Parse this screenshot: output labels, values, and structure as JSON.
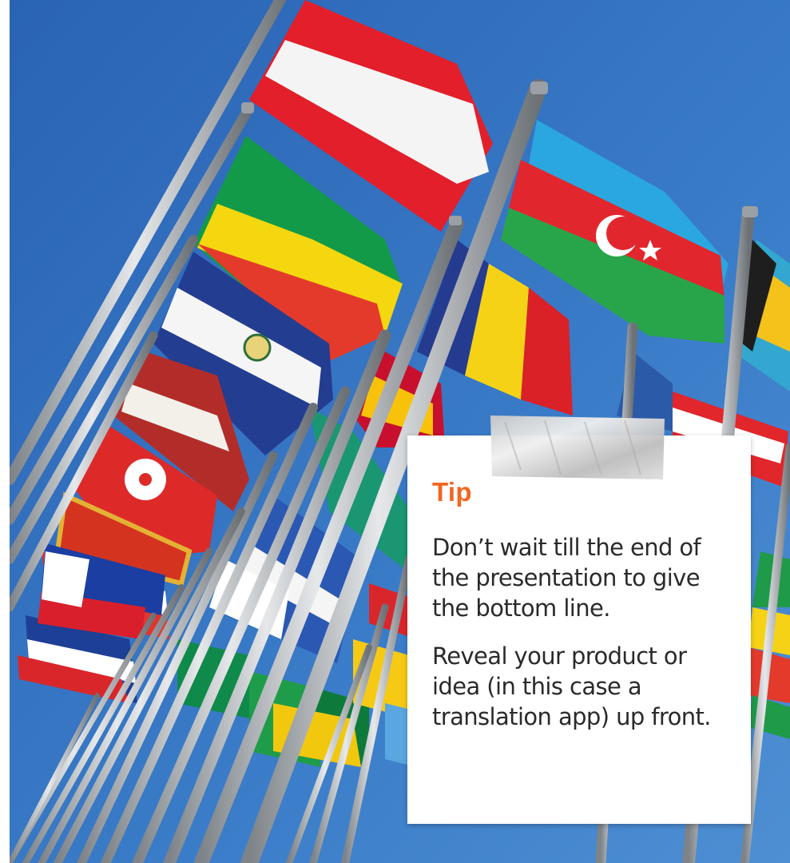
{
  "tip": {
    "title": "Tip",
    "paragraphs": [
      "Don’t wait till the end of the presentation to give the bottom line.",
      "Reveal your product or idea (in this case a translation app) up front."
    ]
  },
  "colors": {
    "sky": "#2f6fbf",
    "accent": "#f26522",
    "text": "#2a2a2a",
    "card": "#ffffff"
  }
}
